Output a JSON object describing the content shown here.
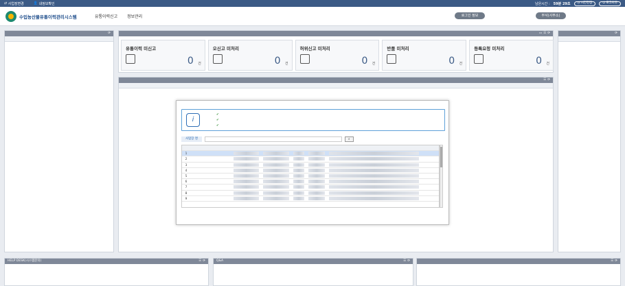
{
  "topbar": {
    "item1": "사업장변경",
    "item2": "내정보확인",
    "time_label": "남은시간 :",
    "time_value": "59분 29초",
    "extend_btn": "시간연장",
    "logout_btn": "로그아웃"
  },
  "header": {
    "logo_sub": "",
    "logo_title": "수입농산물유통이력관리시스템",
    "nav": [
      "유통이력신고",
      "정보관리"
    ],
    "login_info_btn": "로그인 정보",
    "bureau_btn": "부서(사무소)"
  },
  "left_panel": {
    "title": "",
    "columns": [
      "",
      "",
      "",
      ""
    ],
    "empty": ""
  },
  "status_panel": {
    "title": "",
    "desc": ""
  },
  "cards": [
    {
      "title": "유통이력 미신고",
      "count": "0",
      "unit": "건"
    },
    {
      "title": "오신고 미처리",
      "count": "0",
      "unit": "건"
    },
    {
      "title": "허위신고 미처리",
      "count": "0",
      "unit": "건"
    },
    {
      "title": "반품 미처리",
      "count": "0",
      "unit": "건"
    },
    {
      "title": "등록요청 미처리",
      "count": "0",
      "unit": "건"
    }
  ],
  "notice_panel": {
    "title": "",
    "col_title": "",
    "col_date": ""
  },
  "right_panel": {
    "title": "",
    "columns": [
      "",
      ""
    ],
    "empty": ""
  },
  "bottom": {
    "help": "HELP DESK(시스템문의)",
    "qa": "Q&A",
    "data": ""
  },
  "modal": {
    "title": "",
    "messages": [
      "",
      "",
      ""
    ],
    "search_label": "사업장 명",
    "search_placeholder": "",
    "search_btn": "",
    "columns": [
      "",
      "",
      "",
      "",
      "",
      "",
      "",
      ""
    ],
    "rows": [
      {
        "no": "1",
        "type": "",
        "select": ""
      },
      {
        "no": "2",
        "type": "",
        "select": ""
      },
      {
        "no": "3",
        "type": "",
        "select": ""
      },
      {
        "no": "4",
        "type": "",
        "select": ""
      },
      {
        "no": "5",
        "type": "",
        "select": ""
      },
      {
        "no": "6",
        "type": "",
        "select": ""
      },
      {
        "no": "7",
        "type": "",
        "select": ""
      },
      {
        "no": "8",
        "type": "",
        "select": ""
      },
      {
        "no": "9",
        "type": "",
        "select": ""
      }
    ]
  },
  "colors": {
    "topbar": "#3b5a85",
    "panel_header": "#7f8898",
    "accent_blue": "#1f5fb8",
    "count_blue": "#3b5a85"
  }
}
